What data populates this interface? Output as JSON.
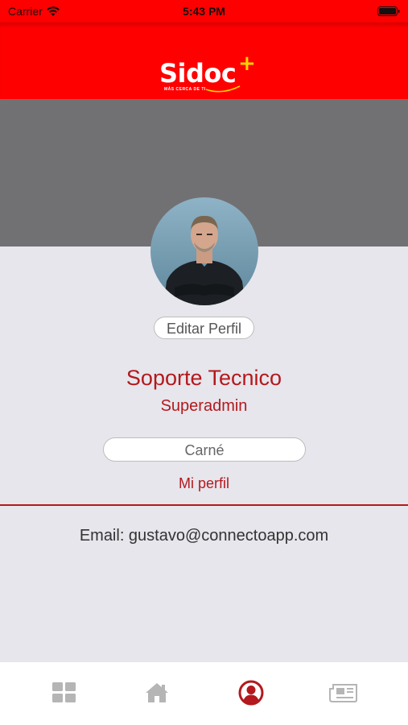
{
  "status_bar": {
    "carrier": "Carrier",
    "time": "5:43 PM"
  },
  "header": {
    "logo_text": "Sidoc",
    "logo_plus": "+",
    "logo_tagline": "MÁS CERCA DE TI",
    "brand_color": "#ff0000"
  },
  "profile": {
    "edit_label": "Editar Perfil",
    "name": "Soporte Tecnico",
    "role": "Superadmin",
    "carne_label": "Carné",
    "mi_perfil_label": "Mi perfil",
    "email_text": "Email: gustavo@connectoapp.com"
  },
  "colors": {
    "accent": "#b3191d",
    "banner": "#717173",
    "background": "#e6e6ec"
  },
  "tabbar": {
    "tabs": [
      {
        "icon": "grid-icon",
        "active": false
      },
      {
        "icon": "home-icon",
        "active": false
      },
      {
        "icon": "user-icon",
        "active": true
      },
      {
        "icon": "newspaper-icon",
        "active": false
      }
    ]
  }
}
